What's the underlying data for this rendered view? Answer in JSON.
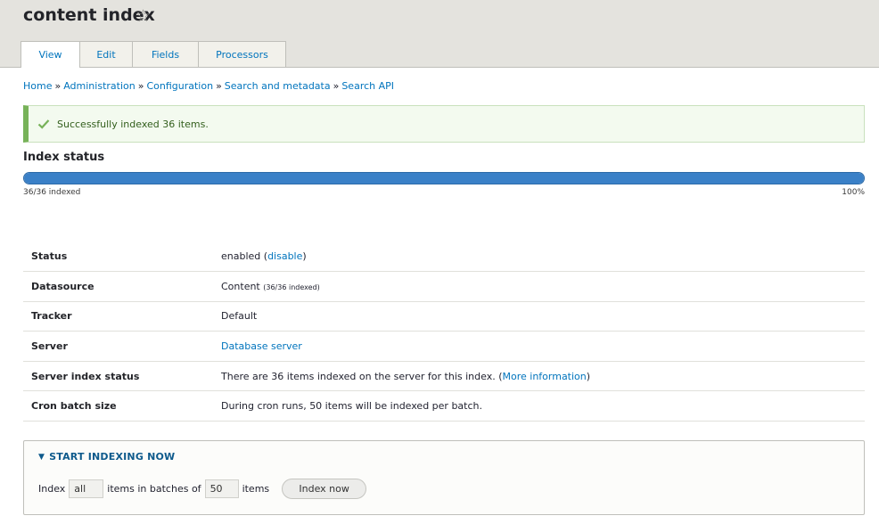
{
  "header": {
    "title": "content index",
    "favorite_icon": "star-outline-icon"
  },
  "tabs": [
    {
      "label": "View",
      "active": true
    },
    {
      "label": "Edit",
      "active": false
    },
    {
      "label": "Fields",
      "active": false
    },
    {
      "label": "Processors",
      "active": false
    }
  ],
  "breadcrumb": {
    "separator": "»",
    "items": [
      "Home",
      "Administration",
      "Configuration",
      "Search and metadata",
      "Search API"
    ]
  },
  "message": {
    "icon": "check-icon",
    "text": "Successfully indexed 36 items."
  },
  "index_status": {
    "title": "Index status",
    "progress_fraction": 1.0,
    "indexed_label": "36/36 indexed",
    "percent_label": "100%"
  },
  "details": {
    "status": {
      "label": "Status",
      "value_prefix": "enabled (",
      "link": "disable",
      "value_suffix": ")"
    },
    "datasource": {
      "label": "Datasource",
      "value": "Content",
      "detail": "(36/36 indexed)"
    },
    "tracker": {
      "label": "Tracker",
      "value": "Default"
    },
    "server": {
      "label": "Server",
      "link": "Database server"
    },
    "server_index_status": {
      "label": "Server index status",
      "value_prefix": "There are 36 items indexed on the server for this index. (",
      "link": "More information",
      "value_suffix": ")"
    },
    "cron_batch_size": {
      "label": "Cron batch size",
      "value": "During cron runs, 50 items will be indexed per batch."
    }
  },
  "indexing": {
    "legend": "START INDEXING NOW",
    "legend_icon": "triangle-down-icon",
    "label_index": "Index",
    "count_value": "all",
    "label_batches": "items in batches of",
    "batch_value": "50",
    "label_items": "items",
    "button_label": "Index now"
  },
  "colors": {
    "link": "#0074bd",
    "success_border": "#77b259",
    "progress_fill": "#3a80c7",
    "header_bg": "#e4e3de"
  }
}
